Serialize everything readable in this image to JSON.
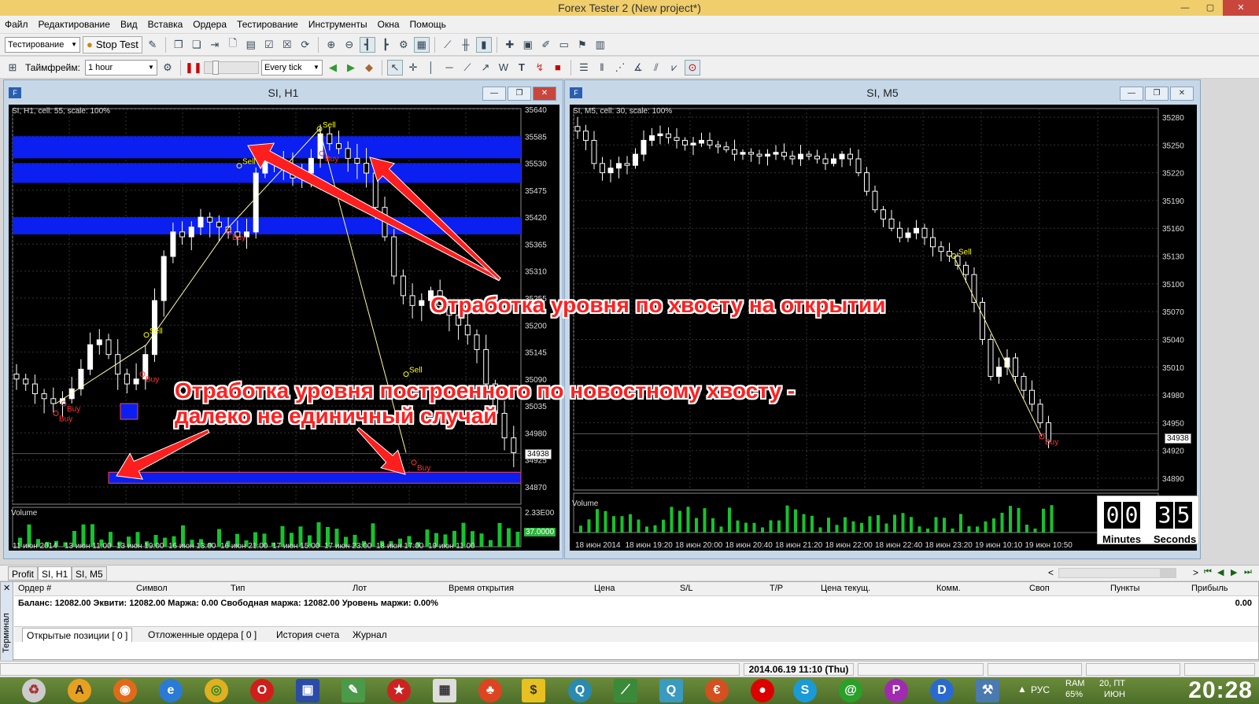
{
  "window": {
    "title": "Forex Tester 2  (New project*)"
  },
  "menu": [
    "Файл",
    "Редактирование",
    "Вид",
    "Вставка",
    "Ордера",
    "Тестирование",
    "Инструменты",
    "Окна",
    "Помощь"
  ],
  "toolbar": {
    "mode_select": "Тестирование",
    "stop_test": "Stop Test",
    "timeframe_label": "Таймфрейм:",
    "timeframe_value": "1 hour",
    "tick_mode": "Every tick"
  },
  "chart_h1": {
    "window_title": "SI, H1",
    "info": "SI, H1, cell: 55, scale: 100%",
    "volume_label": "Volume",
    "y_ticks": [
      "35640",
      "35585",
      "35530",
      "35475",
      "35420",
      "35365",
      "35310",
      "35255",
      "35200",
      "35145",
      "35090",
      "35035",
      "34980",
      "34925",
      "34870"
    ],
    "x_ticks": [
      "11 июн 2014",
      "13 июн 11:00",
      "13 июн 19:00",
      "16 июн 13:00",
      "16 июн 21:00",
      "17 июн 15:00",
      "17 июн 23:00",
      "18 июн 17:00",
      "19 июн 11:00"
    ],
    "current_price": "34938",
    "volume_max": "2.33E00",
    "volume_current": "37.0000",
    "order_labels": [
      "Sell",
      "Sell",
      "Buy",
      "Sell",
      "Buy",
      "Buy",
      "Buy",
      "Buy",
      "Sell",
      "Buy"
    ]
  },
  "chart_m5": {
    "window_title": "SI, M5",
    "info": "SI, M5, cell: 30, scale: 100%",
    "volume_label": "Volume",
    "y_ticks": [
      "35280",
      "35250",
      "35220",
      "35190",
      "35160",
      "35130",
      "35100",
      "35070",
      "35040",
      "35010",
      "34980",
      "34950",
      "34920",
      "34890"
    ],
    "x_ticks": [
      "18 июн 2014",
      "18 июн 19:20",
      "18 июн 20:00",
      "18 июн 20:40",
      "18 июн 21:20",
      "18 июн 22:00",
      "18 июн 22:40",
      "18 июн 23:20",
      "19 июн 10:10",
      "19 июн 10:50"
    ],
    "current_price": "34938",
    "order_labels": [
      "Sell",
      "Buy"
    ]
  },
  "annotations": {
    "line1": "Отработка уровня по хвосту на открытии",
    "line2a": "Отработка уровня построенного по новостному хвосту -",
    "line2b": "далеко не единичный случай"
  },
  "timer": {
    "m1": "0",
    "m2": "0",
    "s1": "3",
    "s2": "5",
    "minutes": "Minutes",
    "seconds": "Seconds"
  },
  "window_tabs": [
    "Profit",
    "SI, H1",
    "SI, M5"
  ],
  "terminal": {
    "side_label": "Терминал",
    "columns": [
      "Ордер #",
      "Символ",
      "Тип",
      "Лот",
      "Время открытия",
      "Цена",
      "S/L",
      "T/P",
      "Цена текущ.",
      "Комм.",
      "Своп",
      "Пункты",
      "Прибыль"
    ],
    "balance_line": "Баланс: 12082.00  Эквити: 12082.00  Маржа: 0.00  Свободная маржа: 12082.00  Уровень маржи: 0.00%",
    "profit_total": "0.00",
    "tabs": [
      "Открытые позиции  [ 0 ]",
      "Отложенные ордера  [ 0 ]",
      "История счета",
      "Журнал"
    ]
  },
  "status": {
    "datetime": "2014.06.19 11:10 (Thu)"
  },
  "tray": {
    "lang": "РУС",
    "ram": "RAM",
    "ram_pct": "65%",
    "date_top": "20, ПТ",
    "date_bottom": "ИЮН",
    "clock": "20:28"
  },
  "colors": {
    "level_band": "#0a1ff0",
    "bull": "#ffffff",
    "bear": "#ffffff",
    "volume": "#17c22e",
    "arrow": "#ff1e1e",
    "title_bar": "#f0ce6c"
  }
}
